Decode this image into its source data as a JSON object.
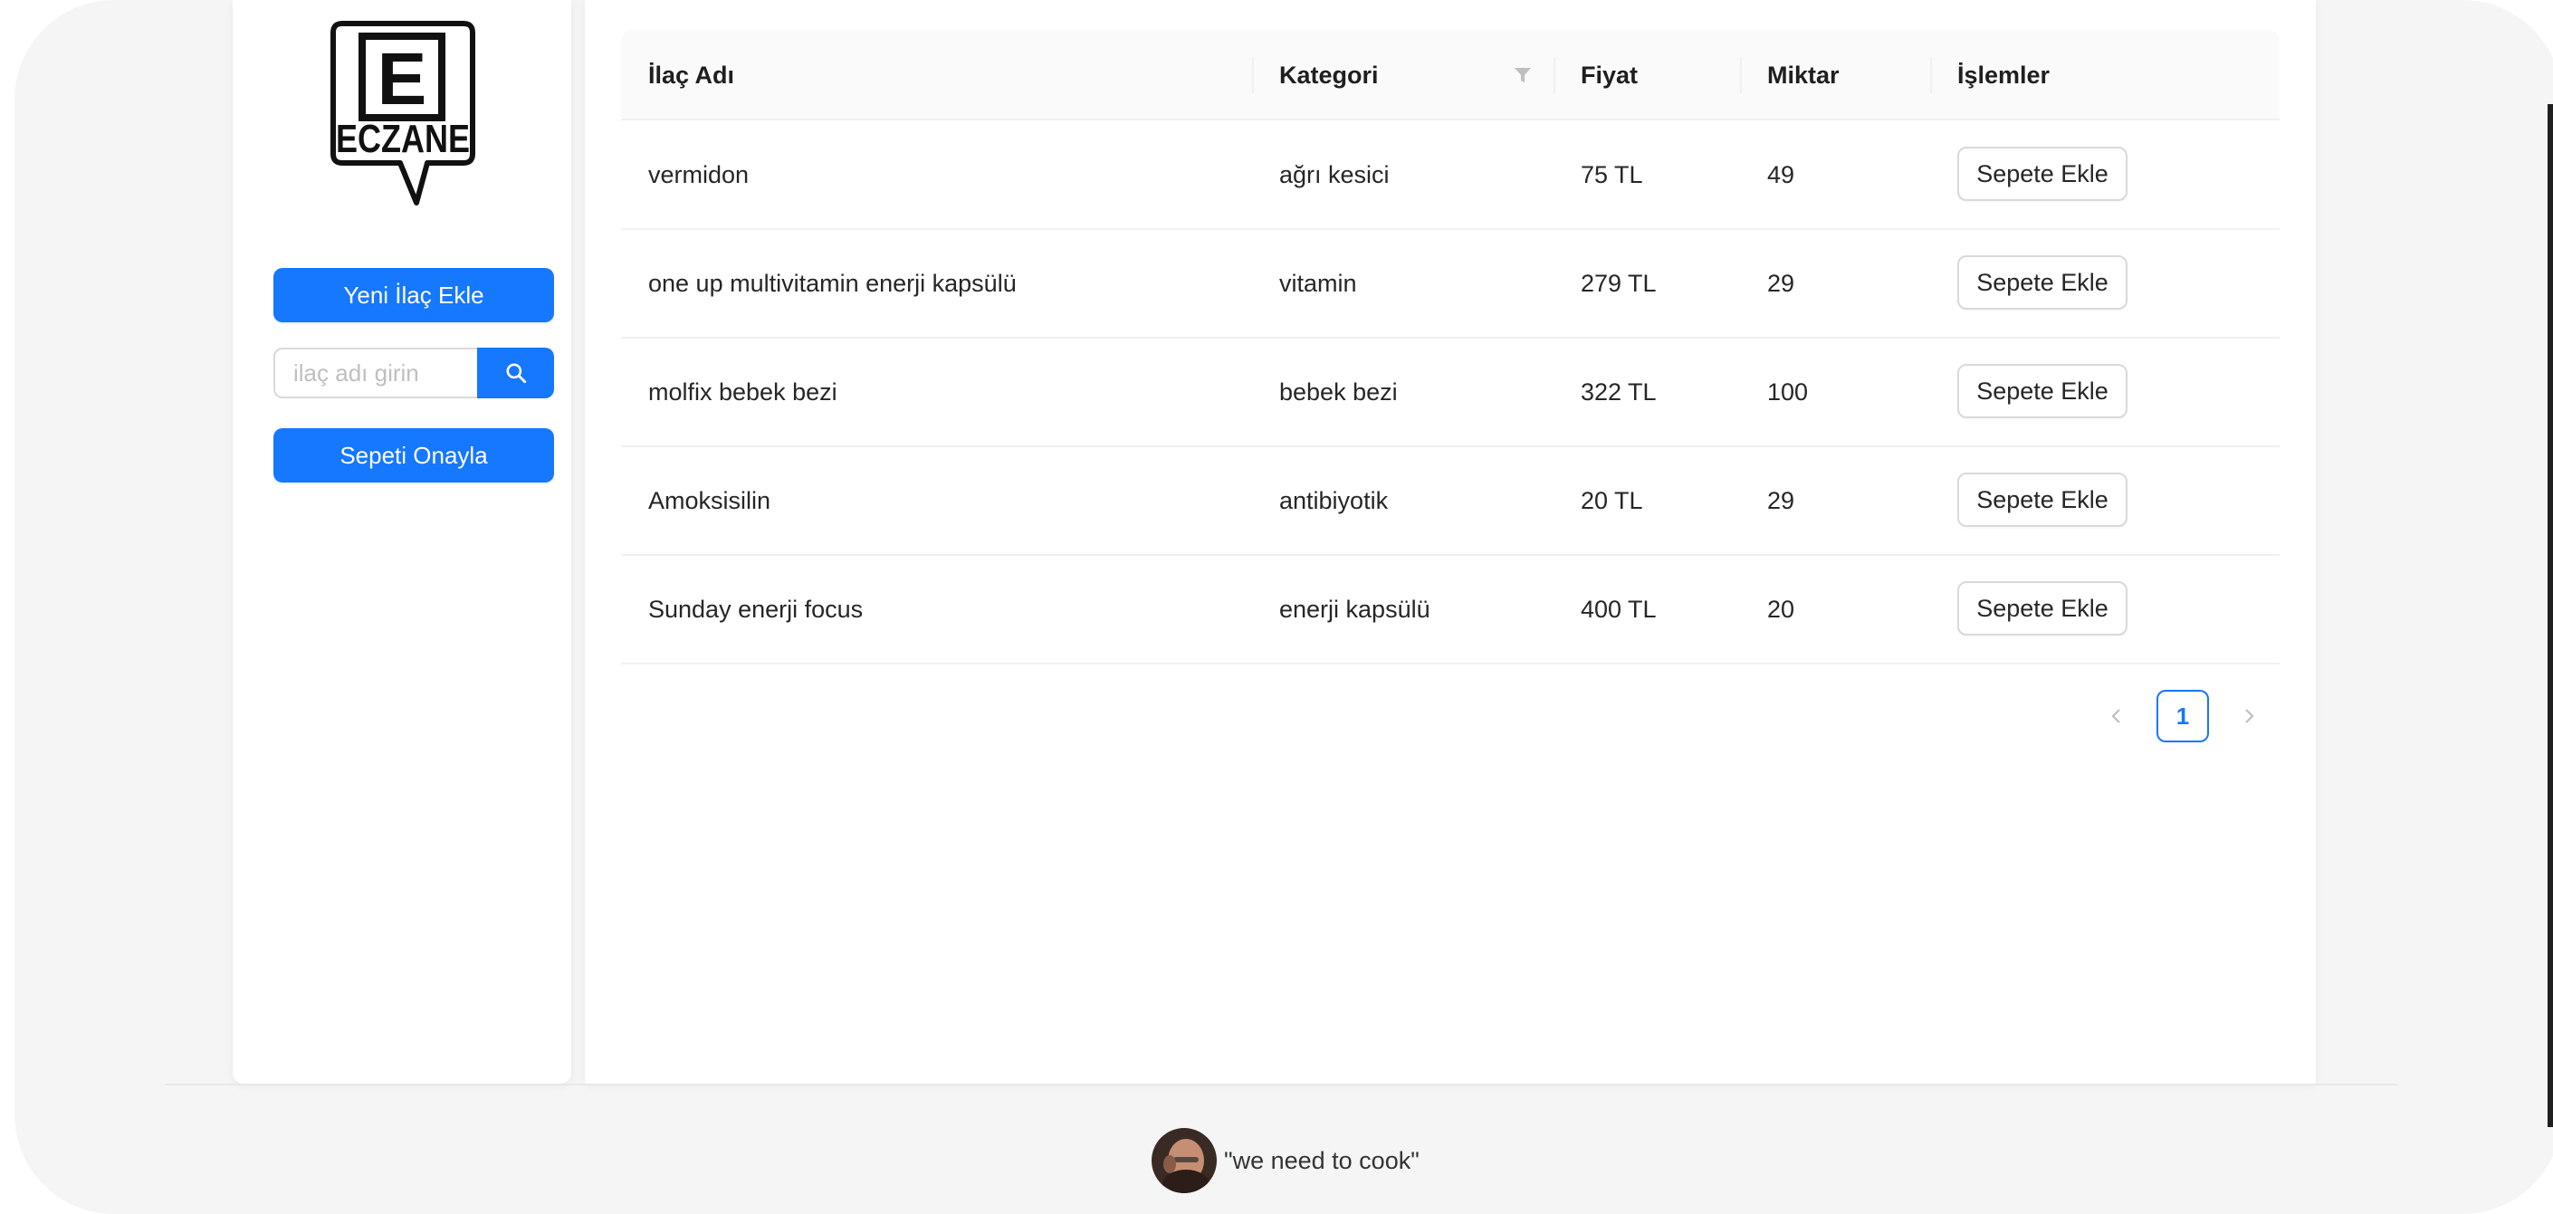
{
  "logo": {
    "letter": "E",
    "word": "ECZANE"
  },
  "sidebar": {
    "add_button": "Yeni İlaç Ekle",
    "search_placeholder": "ilaç adı girin",
    "search_icon": "search-icon",
    "confirm_button": "Sepeti Onayla"
  },
  "table": {
    "columns": [
      "İlaç Adı",
      "Kategori",
      "Fiyat",
      "Miktar",
      "İşlemler"
    ],
    "filter_icon": "filter-icon",
    "action_label": "Sepete Ekle",
    "rows": [
      {
        "name": "vermidon",
        "category": "ağrı kesici",
        "price": "75 TL",
        "quantity": "49"
      },
      {
        "name": "one up multivitamin enerji kapsülü",
        "category": "vitamin",
        "price": "279 TL",
        "quantity": "29"
      },
      {
        "name": "molfix bebek bezi",
        "category": "bebek bezi",
        "price": "322 TL",
        "quantity": "100"
      },
      {
        "name": "Amoksisilin",
        "category": "antibiyotik",
        "price": "20 TL",
        "quantity": "29"
      },
      {
        "name": "Sunday enerji focus",
        "category": "enerji kapsülü",
        "price": "400 TL",
        "quantity": "20"
      }
    ]
  },
  "pagination": {
    "current_page": "1",
    "prev_icon": "chevron-left-icon",
    "next_icon": "chevron-right-icon"
  },
  "footer": {
    "quote": "\"we need to cook\""
  },
  "colors": {
    "primary": "#1677ff",
    "border": "#d9d9d9",
    "header_bg": "#fafafa"
  }
}
